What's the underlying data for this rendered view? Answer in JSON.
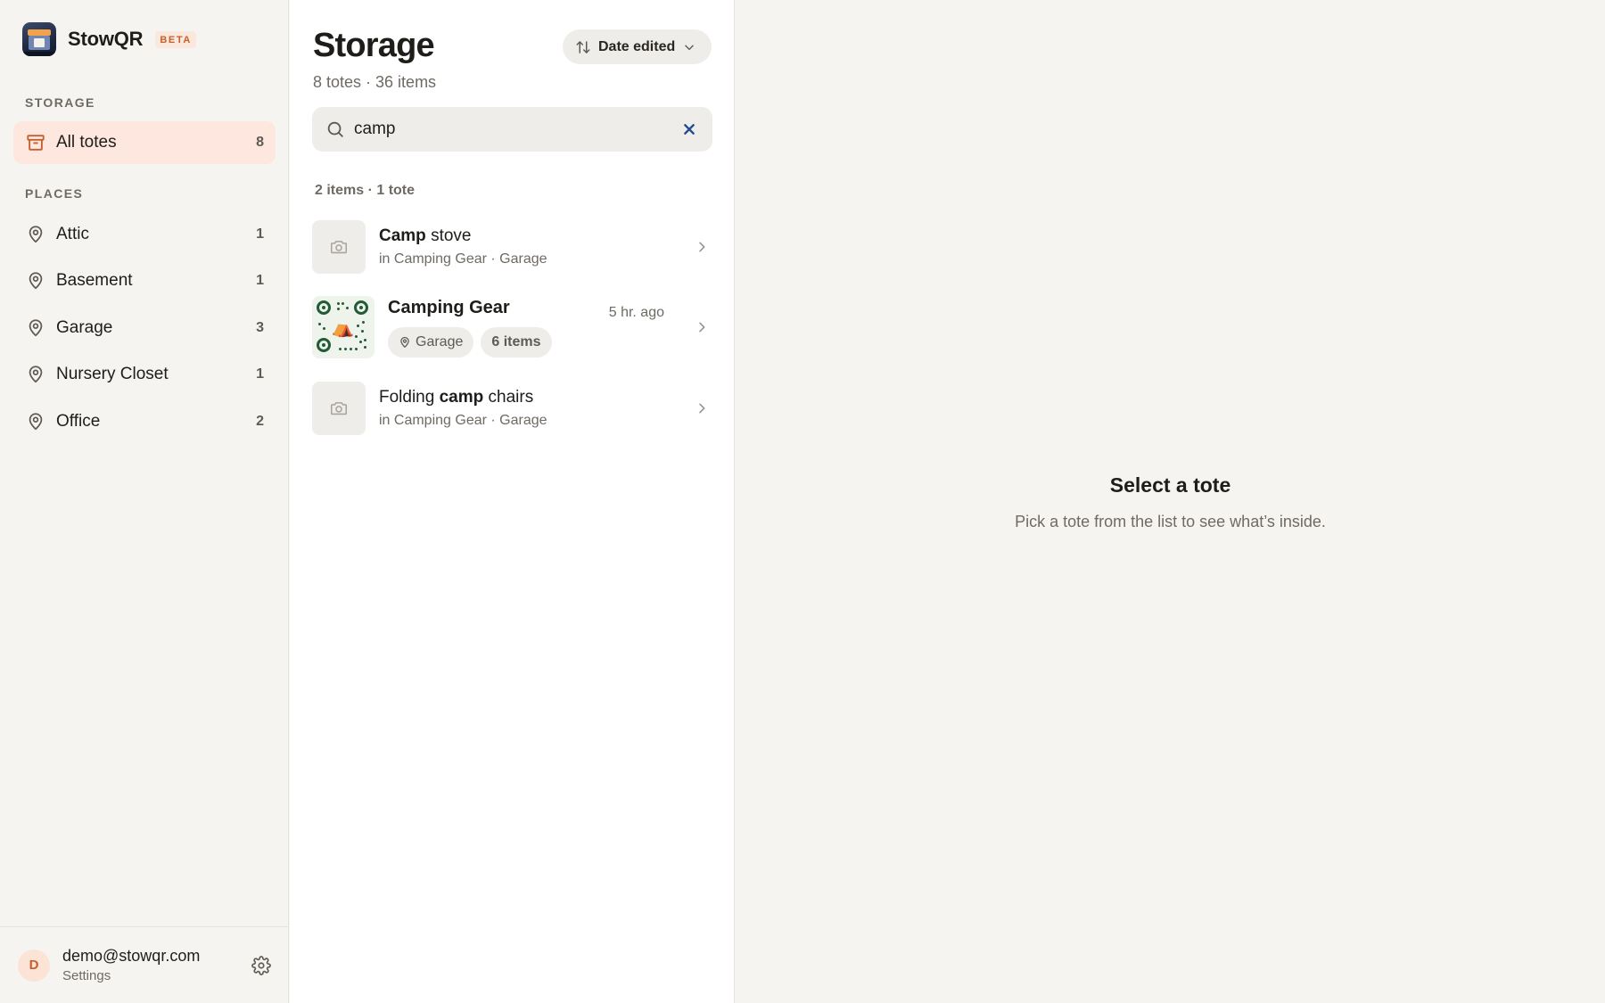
{
  "app": {
    "name": "StowQR",
    "badge": "BETA"
  },
  "sidebar": {
    "storage_label": "STORAGE",
    "all_totes": {
      "label": "All totes",
      "count": "8"
    },
    "places_label": "PLACES",
    "places": [
      {
        "label": "Attic",
        "count": "1"
      },
      {
        "label": "Basement",
        "count": "1"
      },
      {
        "label": "Garage",
        "count": "3"
      },
      {
        "label": "Nursery Closet",
        "count": "1"
      },
      {
        "label": "Office",
        "count": "2"
      }
    ],
    "account": {
      "initial": "D",
      "email": "demo@stowqr.com",
      "settings_label": "Settings"
    }
  },
  "list": {
    "title": "Storage",
    "subtitle": "8 totes · 36 items",
    "sort_label": "Date edited",
    "search_value": "camp",
    "result_summary": "2 items · 1 tote",
    "results": [
      {
        "type": "item",
        "title_match": "Camp",
        "title_rest": " stove",
        "subtitle": "in Camping Gear · Garage"
      },
      {
        "type": "tote",
        "title": "Camping Gear",
        "time": "5 hr. ago",
        "place_chip": "Garage",
        "count_chip": "6 items"
      },
      {
        "type": "item",
        "title_pre": "Folding ",
        "title_match": "camp",
        "title_rest": " chairs",
        "subtitle": "in Camping Gear · Garage"
      }
    ]
  },
  "detail": {
    "title": "Select a tote",
    "subtitle": "Pick a tote from the list to see what’s inside."
  },
  "colors": {
    "accent": "#c3612e",
    "active_bg": "#fde7de",
    "qr_green": "#215c36"
  }
}
